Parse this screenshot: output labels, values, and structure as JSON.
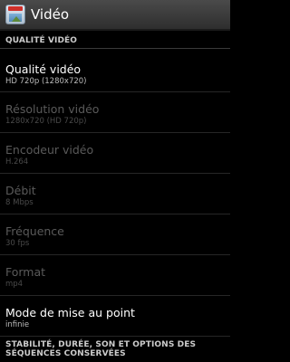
{
  "header": {
    "title": "Vidéo",
    "icon": "video-camera-app-icon"
  },
  "section_quality": {
    "label": "QUALITÉ VIDÉO"
  },
  "preferences": [
    {
      "title": "Qualité vidéo",
      "summary": "HD 720p (1280x720)",
      "enabled": true
    },
    {
      "title": "Résolution vidéo",
      "summary": "1280x720 (HD 720p)",
      "enabled": false
    },
    {
      "title": "Encodeur vidéo",
      "summary": "H.264",
      "enabled": false
    },
    {
      "title": "Débit",
      "summary": "8 Mbps",
      "enabled": false
    },
    {
      "title": "Fréquence",
      "summary": "30 fps",
      "enabled": false
    },
    {
      "title": "Format",
      "summary": "mp4",
      "enabled": false
    },
    {
      "title": "Mode de mise au point",
      "summary": "infinie",
      "enabled": true
    }
  ],
  "section_stability": {
    "label": "STABILITÉ, DURÉE, SON ET OPTIONS DES SÉQUENCES CONSERVÉES"
  }
}
